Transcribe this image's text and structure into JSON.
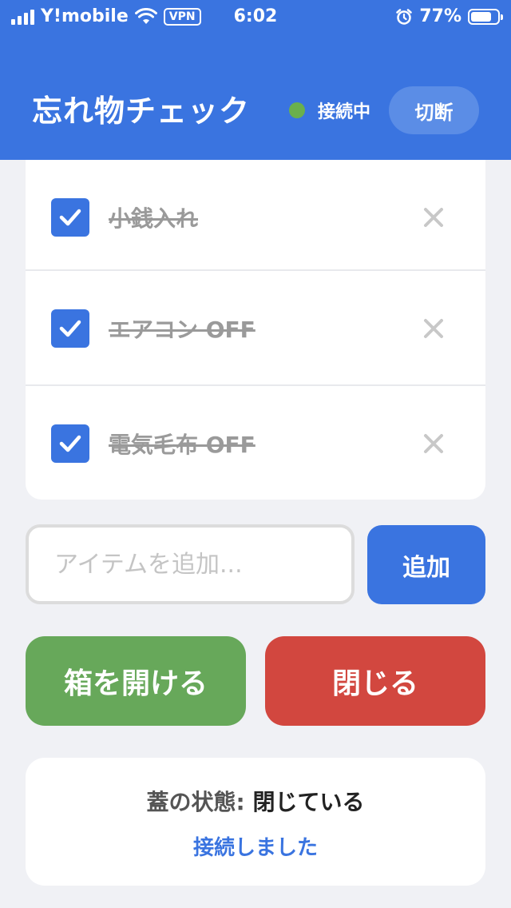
{
  "status_bar": {
    "carrier": "Y!mobile",
    "vpn": "VPN",
    "time": "6:02",
    "battery": "77%",
    "battery_level": 0.77,
    "icons": [
      "signal-icon",
      "wifi-icon",
      "alarm-icon",
      "battery-icon"
    ]
  },
  "header": {
    "title": "忘れ物チェック",
    "connection_status": "接続中",
    "connection_color": "#6ab04c",
    "disconnect_label": "切断"
  },
  "items": [
    {
      "label": "小銭入れ",
      "checked": true
    },
    {
      "label": "エアコン OFF",
      "checked": true
    },
    {
      "label": "電気毛布 OFF",
      "checked": true
    }
  ],
  "add_form": {
    "placeholder": "アイテムを追加...",
    "value": "",
    "button_label": "追加"
  },
  "actions": {
    "open_label": "箱を開ける",
    "close_label": "閉じる"
  },
  "status_card": {
    "lid_label": "蓋の状態:",
    "lid_value": "閉じている",
    "message": "接続しました"
  },
  "colors": {
    "primary": "#3a74e0",
    "open": "#67a85a",
    "close": "#d2473f",
    "background": "#f0f1f5"
  }
}
